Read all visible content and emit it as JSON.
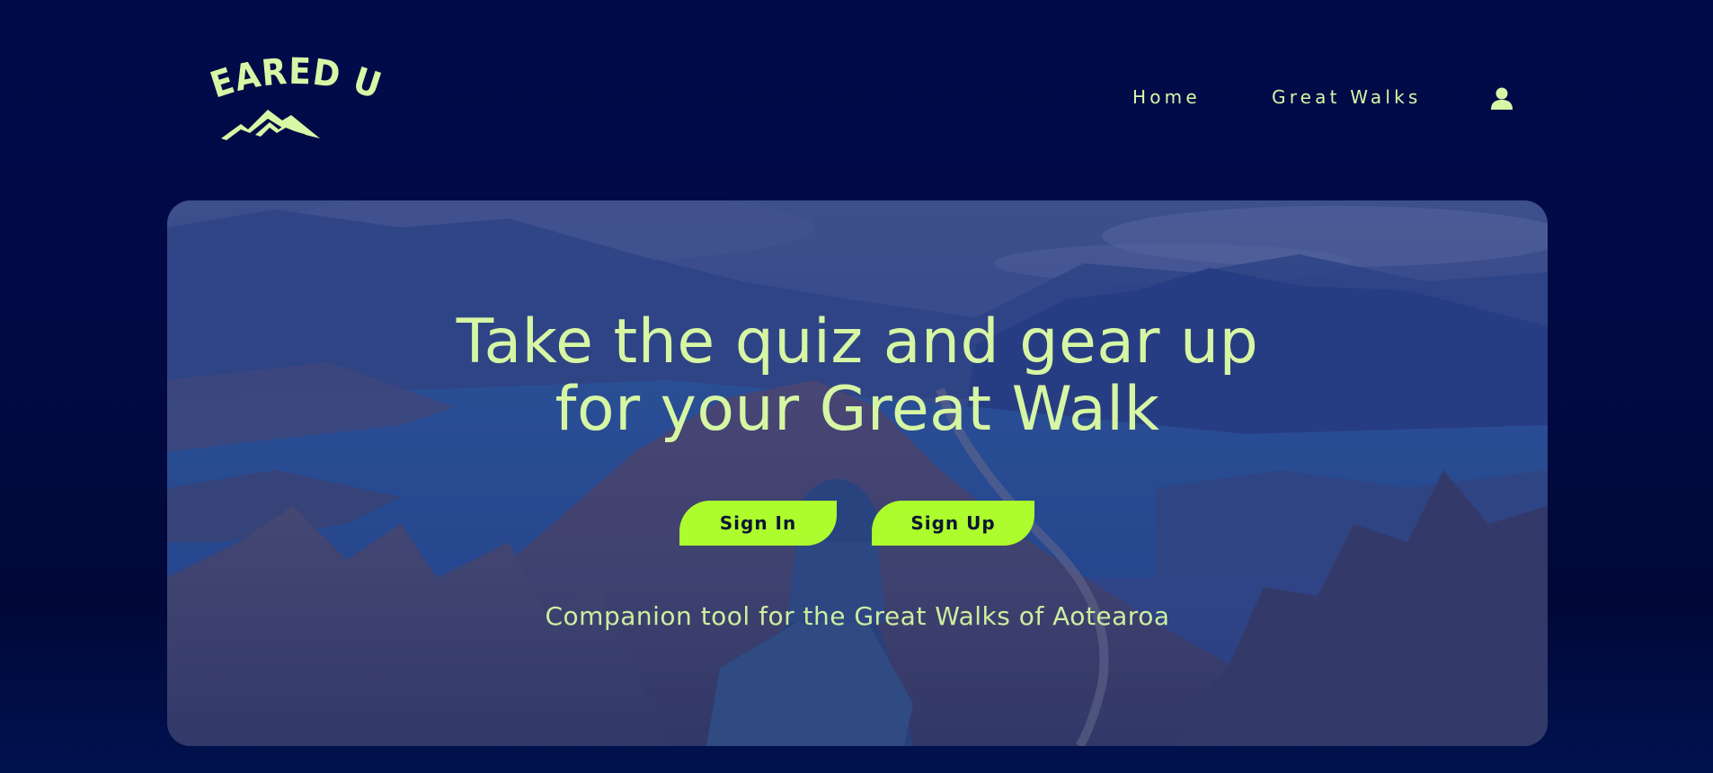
{
  "brand": {
    "logo_text": "GEARED UP",
    "logo_icon": "mountain-icon"
  },
  "nav": {
    "home": "Home",
    "great_walks": "Great Walks",
    "user_icon": "user-icon"
  },
  "hero": {
    "title_line1": "Take the quiz and gear up",
    "title_line2": "for your Great Walk",
    "sign_in": "Sign In",
    "sign_up": "Sign Up",
    "subtitle": "Companion tool for the Great Walks of Aotearoa"
  },
  "colors": {
    "background": "#010a45",
    "accent_text": "#d7f6a4",
    "button": "#adfc2e",
    "button_text": "#0b1533"
  }
}
